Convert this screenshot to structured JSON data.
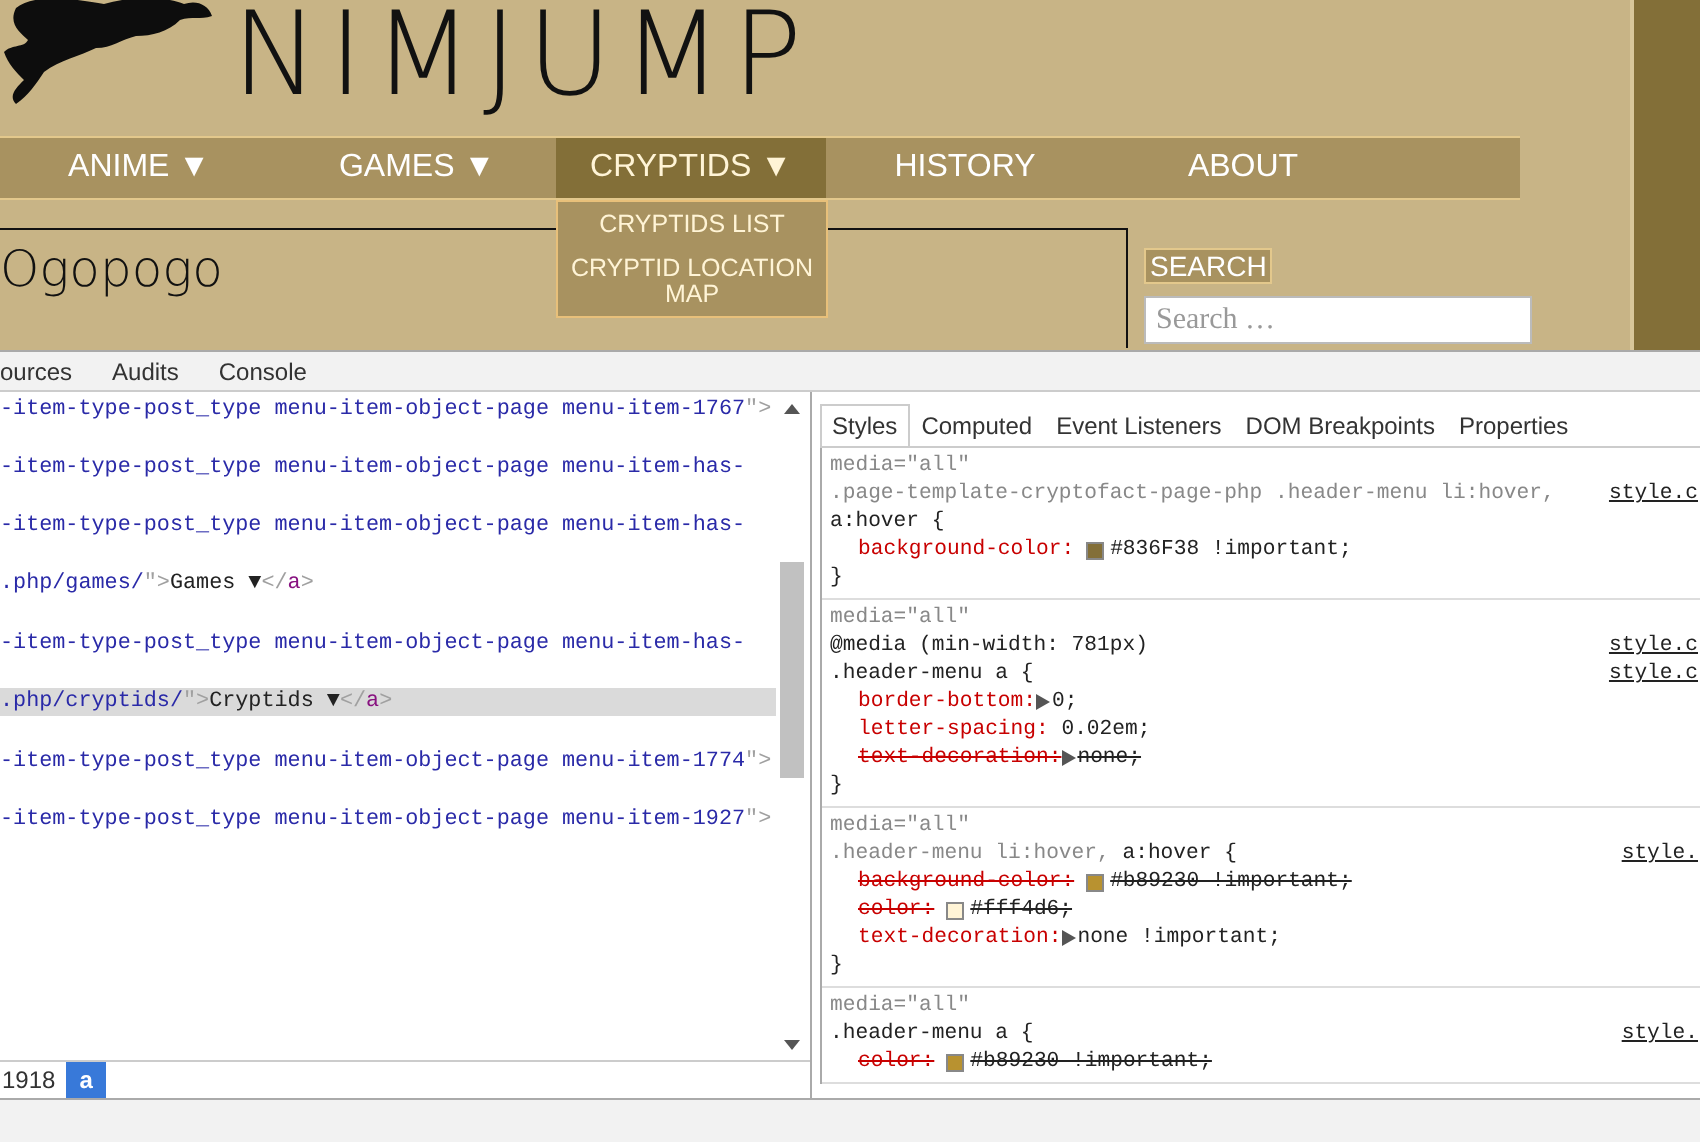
{
  "site": {
    "logo": "NIMJUMP",
    "nav": [
      {
        "label": "ANIME ▼",
        "selected": false
      },
      {
        "label": "GAMES ▼",
        "selected": false
      },
      {
        "label": "CRYPTIDS ▼",
        "selected": true,
        "submenu": [
          "CRYPTIDS LIST",
          "CRYPTID LOCATION MAP"
        ]
      },
      {
        "label": "HISTORY",
        "selected": false
      },
      {
        "label": "ABOUT",
        "selected": false
      }
    ],
    "page_title": "Ogopogo",
    "search": {
      "label": "SEARCH",
      "placeholder": "Search …"
    }
  },
  "devtools": {
    "tabs": [
      "ources",
      "Audits",
      "Console"
    ],
    "dom_tree": {
      "groups": [
        {
          "lines": [
            {
              "selected": false,
              "segments": [
                {
                  "kind": "value",
                  "text": "-item-type-post_type menu-item-object-page menu-item-1767"
                },
                {
                  "kind": "punct",
                  "text": "\">"
                }
              ]
            },
            {
              "selected": false,
              "segments": [
                {
                  "kind": "value",
                  "text": "-item-type-post_type menu-item-object-page menu-item-has-"
                }
              ]
            },
            {
              "selected": false,
              "segments": [
                {
                  "kind": "value",
                  "text": "-item-type-post_type menu-item-object-page menu-item-has-"
                }
              ]
            },
            {
              "selected": false,
              "segments": [
                {
                  "kind": "value",
                  "text": ".php/games/"
                },
                {
                  "kind": "punct",
                  "text": "\">"
                },
                {
                  "kind": "text",
                  "text": "Games ▼"
                },
                {
                  "kind": "punct",
                  "text": "</"
                },
                {
                  "kind": "tag",
                  "text": "a"
                },
                {
                  "kind": "punct",
                  "text": ">"
                }
              ]
            }
          ]
        },
        {
          "lines": [
            {
              "selected": false,
              "segments": [
                {
                  "kind": "value",
                  "text": "-item-type-post_type menu-item-object-page menu-item-has-"
                }
              ]
            },
            {
              "selected": true,
              "segments": [
                {
                  "kind": "value",
                  "text": ".php/cryptids/"
                },
                {
                  "kind": "punct",
                  "text": "\">"
                },
                {
                  "kind": "text",
                  "text": "Cryptids ▼"
                },
                {
                  "kind": "punct",
                  "text": "</"
                },
                {
                  "kind": "tag",
                  "text": "a"
                },
                {
                  "kind": "punct",
                  "text": ">"
                }
              ]
            }
          ]
        },
        {
          "lines": [
            {
              "selected": false,
              "segments": [
                {
                  "kind": "value",
                  "text": "-item-type-post_type menu-item-object-page menu-item-1774"
                },
                {
                  "kind": "punct",
                  "text": "\">"
                }
              ]
            },
            {
              "selected": false,
              "segments": [
                {
                  "kind": "value",
                  "text": "-item-type-post_type menu-item-object-page menu-item-1927"
                },
                {
                  "kind": "punct",
                  "text": "\">"
                }
              ]
            }
          ]
        }
      ]
    },
    "breadcrumbs": [
      {
        "label": "1918",
        "selected": false
      },
      {
        "label": "a",
        "selected": true
      }
    ],
    "sidebar_tabs": [
      {
        "label": "Styles",
        "selected": true
      },
      {
        "label": "Computed",
        "selected": false
      },
      {
        "label": "Event Listeners",
        "selected": false
      },
      {
        "label": "DOM Breakpoints",
        "selected": false
      },
      {
        "label": "Properties",
        "selected": false
      }
    ],
    "rules": [
      {
        "media": "media=\"all\"",
        "selector_lines": [
          {
            "parts": [
              {
                "text": ".page-template-cryptofact-page-php .header-menu li:hover,",
                "matched": false
              }
            ],
            "source": "style.c"
          },
          {
            "parts": [
              {
                "text": "a:hover {",
                "matched": true
              }
            ]
          }
        ],
        "properties": [
          {
            "name": "background-color:",
            "value": "#836F38 !important;",
            "color": "#836f38",
            "expandable": false,
            "overridden": false
          }
        ],
        "close": "}"
      },
      {
        "media": "media=\"all\"",
        "selector_lines": [
          {
            "parts": [
              {
                "text": "@media (min-width: 781px)",
                "matched": true
              }
            ],
            "source": "style.c"
          },
          {
            "parts": [
              {
                "text": ".header-menu a {",
                "matched": true
              }
            ],
            "source": "style.c"
          }
        ],
        "properties": [
          {
            "name": "border-bottom:",
            "value": "0;",
            "expandable": true,
            "overridden": false
          },
          {
            "name": "letter-spacing:",
            "value": "0.02em;",
            "expandable": false,
            "overridden": false
          },
          {
            "name": "text-decoration:",
            "value": "none;",
            "expandable": true,
            "overridden": true
          }
        ],
        "close": "}"
      },
      {
        "media": "media=\"all\"",
        "selector_lines": [
          {
            "parts": [
              {
                "text": ".header-menu li:hover,",
                "matched": false
              },
              {
                "text": "a:hover {",
                "matched": true
              }
            ],
            "source": "style."
          }
        ],
        "properties": [
          {
            "name": "background-color:",
            "value": "#b89230 !important;",
            "color": "#b89230",
            "expandable": false,
            "overridden": true
          },
          {
            "name": "color:",
            "value": "#fff4d6;",
            "color": "#fff4d6",
            "expandable": false,
            "overridden": true
          },
          {
            "name": "text-decoration:",
            "value": "none !important;",
            "expandable": true,
            "overridden": false
          }
        ],
        "close": "}"
      },
      {
        "media": "media=\"all\"",
        "selector_lines": [
          {
            "parts": [
              {
                "text": ".header-menu a {",
                "matched": true
              }
            ],
            "source": "style."
          }
        ],
        "properties": [
          {
            "name": "color:",
            "value": "#b89230 !important;",
            "color": "#b89230",
            "expandable": false,
            "overridden": true
          }
        ]
      }
    ]
  }
}
